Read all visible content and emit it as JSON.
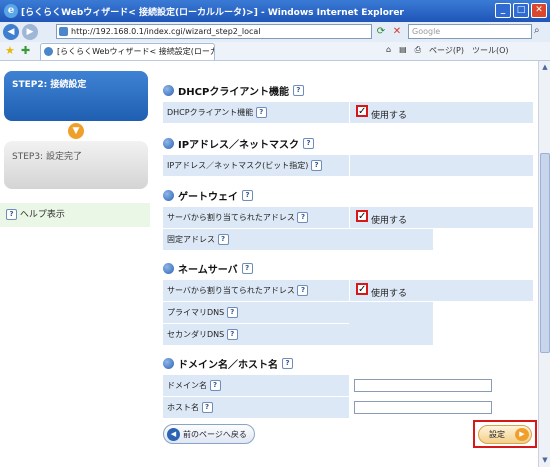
{
  "window": {
    "title": "[らくらくWebウィザード< 接続設定(ローカルルータ)>] - Windows Internet Explorer"
  },
  "browser": {
    "address": "http://192.168.0.1/index.cgi/wizard_step2_local",
    "search_placeholder": "Google",
    "tab_label": "[らくらくWebウィザード< 接続設定(ローカルルータ)>]",
    "page_menu": "ページ(P)",
    "tools_menu": "ツール(O)"
  },
  "sidebar": {
    "step2": "STEP2: 接続設定",
    "step3": "STEP3: 設定完了",
    "help": "ヘルプ表示"
  },
  "sections": {
    "dhcp": {
      "title": "DHCPクライアント機能",
      "rows": [
        {
          "label": "DHCPクライアント機能",
          "checkbox_label": "使用する",
          "checked": true
        }
      ]
    },
    "ip": {
      "title": "IPアドレス／ネットマスク",
      "rows": [
        {
          "label": "IPアドレス／ネットマスク(ビット指定)"
        }
      ]
    },
    "gateway": {
      "title": "ゲートウェイ",
      "rows": [
        {
          "label": "サーバから割り当てられたアドレス",
          "checkbox_label": "使用する",
          "checked": true
        },
        {
          "label": "固定アドレス"
        }
      ]
    },
    "nameserver": {
      "title": "ネームサーバ",
      "rows": [
        {
          "label": "サーバから割り当てられたアドレス",
          "checkbox_label": "使用する",
          "checked": true
        },
        {
          "label": "プライマリDNS"
        },
        {
          "label": "セカンダリDNS"
        }
      ]
    },
    "domain": {
      "title": "ドメイン名／ホスト名",
      "rows": [
        {
          "label": "ドメイン名",
          "value": ""
        },
        {
          "label": "ホスト名",
          "value": ""
        }
      ]
    }
  },
  "buttons": {
    "back": "前のページへ戻る",
    "submit": "設定"
  },
  "colors": {
    "accent": "#1f5fb2",
    "highlight": "#d61818",
    "row_bg": "#dce8f6"
  }
}
